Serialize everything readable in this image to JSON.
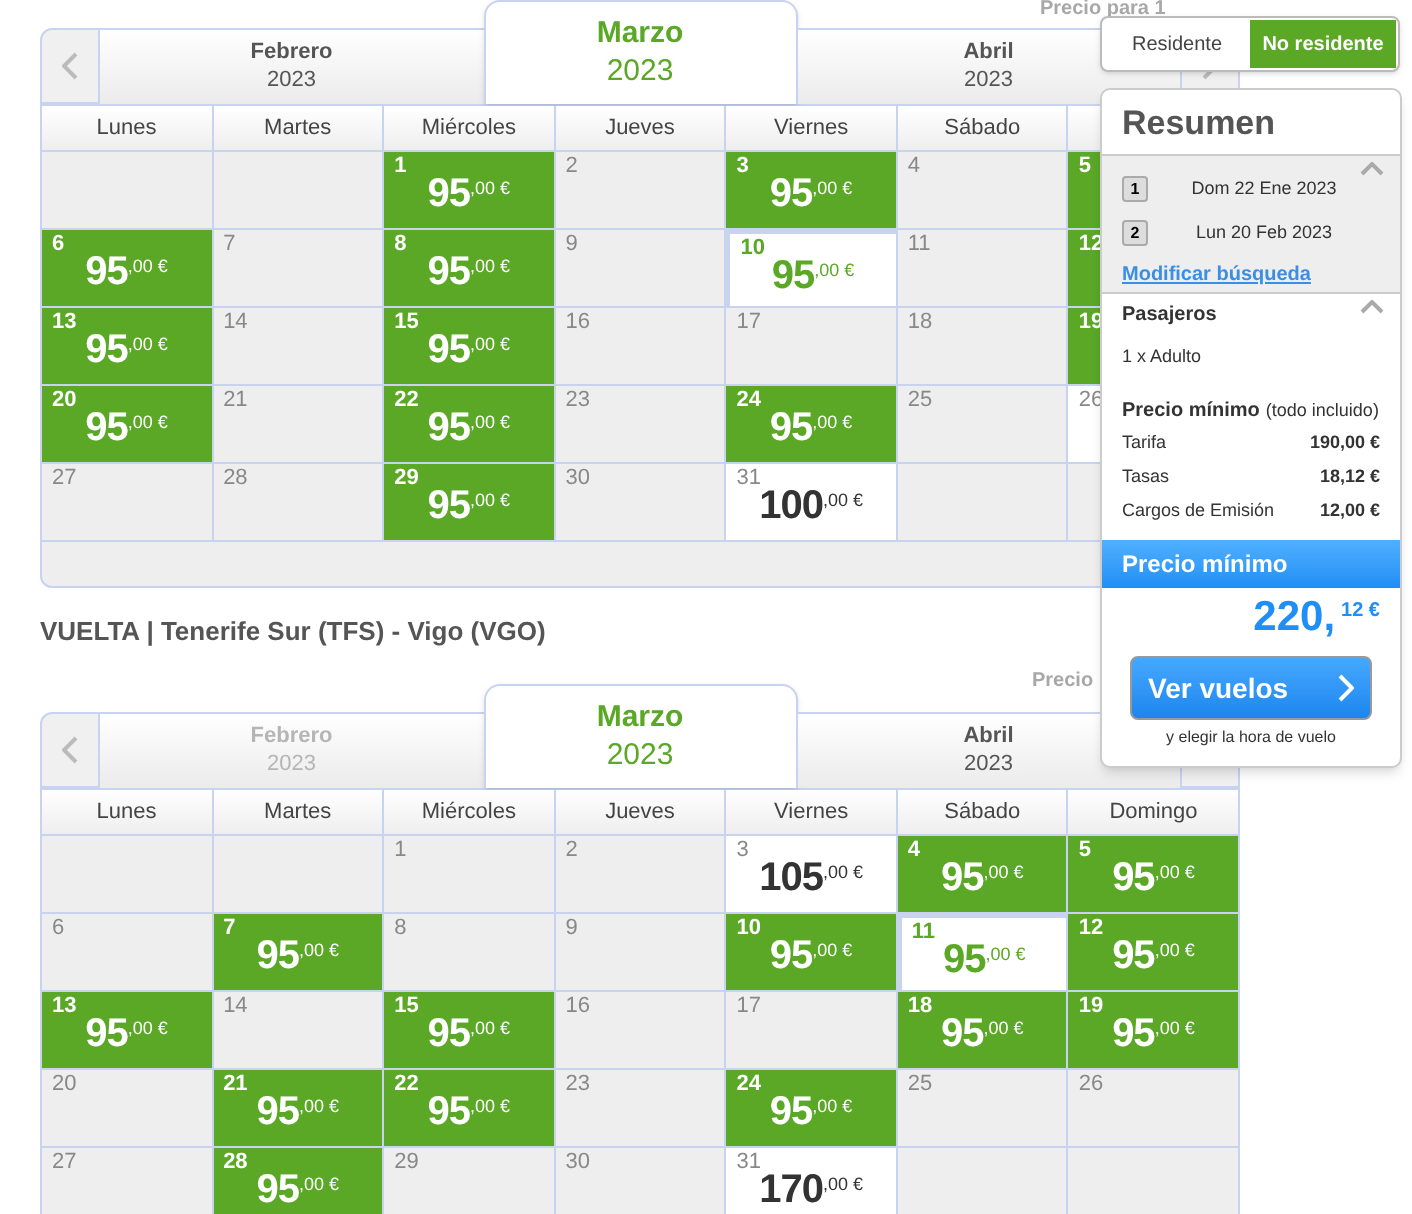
{
  "calendars": [
    {
      "price_note": "Precio para 1",
      "months": [
        {
          "name": "Febrero",
          "year": "2023",
          "selected": false,
          "disabled": false
        },
        {
          "name": "Marzo",
          "year": "2023",
          "selected": true,
          "disabled": false
        },
        {
          "name": "Abril",
          "year": "2023",
          "selected": false,
          "disabled": false
        }
      ],
      "weekdays": [
        "Lunes",
        "Martes",
        "Miércoles",
        "Jueves",
        "Viernes",
        "Sábado"
      ],
      "weeks": [
        [
          {
            "kind": "empty"
          },
          {
            "kind": "empty"
          },
          {
            "day": "1",
            "kind": "offer",
            "price": "95",
            "cents": ",00 €",
            "selected": false
          },
          {
            "day": "2",
            "kind": "closed"
          },
          {
            "day": "3",
            "kind": "offer",
            "price": "95",
            "cents": ",00 €",
            "selected": false
          },
          {
            "day": "4",
            "kind": "closed"
          },
          {
            "day": "5",
            "kind": "offer",
            "selected": false
          }
        ],
        [
          {
            "day": "6",
            "kind": "offer",
            "price": "95",
            "cents": ",00 €",
            "selected": false
          },
          {
            "day": "7",
            "kind": "closed"
          },
          {
            "day": "8",
            "kind": "offer",
            "price": "95",
            "cents": ",00 €",
            "selected": false
          },
          {
            "day": "9",
            "kind": "closed"
          },
          {
            "day": "10",
            "kind": "offer",
            "price": "95",
            "cents": ",00 €",
            "selected": true
          },
          {
            "day": "11",
            "kind": "closed"
          },
          {
            "day": "12",
            "kind": "offer",
            "selected": false
          }
        ],
        [
          {
            "day": "13",
            "kind": "offer",
            "price": "95",
            "cents": ",00 €",
            "selected": false
          },
          {
            "day": "14",
            "kind": "closed"
          },
          {
            "day": "15",
            "kind": "offer",
            "price": "95",
            "cents": ",00 €",
            "selected": false
          },
          {
            "day": "16",
            "kind": "closed"
          },
          {
            "day": "17",
            "kind": "closed"
          },
          {
            "day": "18",
            "kind": "closed"
          },
          {
            "day": "19",
            "kind": "offer",
            "selected": false
          }
        ],
        [
          {
            "day": "20",
            "kind": "offer",
            "price": "95",
            "cents": ",00 €",
            "selected": false
          },
          {
            "day": "21",
            "kind": "closed"
          },
          {
            "day": "22",
            "kind": "offer",
            "price": "95",
            "cents": ",00 €",
            "selected": false
          },
          {
            "day": "23",
            "kind": "closed"
          },
          {
            "day": "24",
            "kind": "offer",
            "price": "95",
            "cents": ",00 €",
            "selected": false
          },
          {
            "day": "25",
            "kind": "closed"
          },
          {
            "day": "26",
            "kind": "priced"
          }
        ],
        [
          {
            "day": "27",
            "kind": "closed"
          },
          {
            "day": "28",
            "kind": "closed"
          },
          {
            "day": "29",
            "kind": "offer",
            "price": "95",
            "cents": ",00 €",
            "selected": false
          },
          {
            "day": "30",
            "kind": "closed"
          },
          {
            "day": "31",
            "kind": "priced",
            "price": "100",
            "cents": ",00 €"
          },
          {
            "kind": "empty"
          },
          {
            "kind": "empty"
          }
        ]
      ]
    },
    {
      "title": "VUELTA | Tenerife Sur (TFS) - Vigo (VGO)",
      "price_note": "Precio",
      "months": [
        {
          "name": "Febrero",
          "year": "2023",
          "selected": false,
          "disabled": true
        },
        {
          "name": "Marzo",
          "year": "2023",
          "selected": true,
          "disabled": false
        },
        {
          "name": "Abril",
          "year": "2023",
          "selected": false,
          "disabled": false
        }
      ],
      "weekdays": [
        "Lunes",
        "Martes",
        "Miércoles",
        "Jueves",
        "Viernes",
        "Sábado",
        "Domingo"
      ],
      "weeks": [
        [
          {
            "kind": "empty"
          },
          {
            "kind": "empty"
          },
          {
            "day": "1",
            "kind": "closed"
          },
          {
            "day": "2",
            "kind": "closed"
          },
          {
            "day": "3",
            "kind": "priced",
            "price": "105",
            "cents": ",00 €"
          },
          {
            "day": "4",
            "kind": "offer",
            "price": "95",
            "cents": ",00 €",
            "selected": false
          },
          {
            "day": "5",
            "kind": "offer",
            "price": "95",
            "cents": ",00 €",
            "selected": false
          }
        ],
        [
          {
            "day": "6",
            "kind": "closed"
          },
          {
            "day": "7",
            "kind": "offer",
            "price": "95",
            "cents": ",00 €",
            "selected": false
          },
          {
            "day": "8",
            "kind": "closed"
          },
          {
            "day": "9",
            "kind": "closed"
          },
          {
            "day": "10",
            "kind": "offer",
            "price": "95",
            "cents": ",00 €",
            "selected": false
          },
          {
            "day": "11",
            "kind": "offer",
            "price": "95",
            "cents": ",00 €",
            "selected": true
          },
          {
            "day": "12",
            "kind": "offer",
            "price": "95",
            "cents": ",00 €",
            "selected": false
          }
        ],
        [
          {
            "day": "13",
            "kind": "offer",
            "price": "95",
            "cents": ",00 €",
            "selected": false
          },
          {
            "day": "14",
            "kind": "closed"
          },
          {
            "day": "15",
            "kind": "offer",
            "price": "95",
            "cents": ",00 €",
            "selected": false
          },
          {
            "day": "16",
            "kind": "closed"
          },
          {
            "day": "17",
            "kind": "closed"
          },
          {
            "day": "18",
            "kind": "offer",
            "price": "95",
            "cents": ",00 €",
            "selected": false
          },
          {
            "day": "19",
            "kind": "offer",
            "price": "95",
            "cents": ",00 €",
            "selected": false
          }
        ],
        [
          {
            "day": "20",
            "kind": "closed"
          },
          {
            "day": "21",
            "kind": "offer",
            "price": "95",
            "cents": ",00 €",
            "selected": false
          },
          {
            "day": "22",
            "kind": "offer",
            "price": "95",
            "cents": ",00 €",
            "selected": false
          },
          {
            "day": "23",
            "kind": "closed"
          },
          {
            "day": "24",
            "kind": "offer",
            "price": "95",
            "cents": ",00 €",
            "selected": false
          },
          {
            "day": "25",
            "kind": "closed"
          },
          {
            "day": "26",
            "kind": "closed"
          }
        ],
        [
          {
            "day": "27",
            "kind": "closed"
          },
          {
            "day": "28",
            "kind": "offer",
            "price": "95",
            "cents": ",00 €",
            "selected": false
          },
          {
            "day": "29",
            "kind": "closed"
          },
          {
            "day": "30",
            "kind": "closed"
          },
          {
            "day": "31",
            "kind": "priced",
            "price": "170",
            "cents": ",00 €"
          },
          {
            "kind": "empty"
          },
          {
            "kind": "empty"
          }
        ]
      ]
    }
  ],
  "fares": [
    {
      "label": "Residente",
      "selected": false
    },
    {
      "label": "No residente",
      "selected": true
    }
  ],
  "summary": {
    "title": "Resumen",
    "search": {
      "expanded": true,
      "flights": [
        {
          "num": "1",
          "date": "Dom 22 Ene 2023"
        },
        {
          "num": "2",
          "date": "Lun 20 Feb 2023"
        }
      ],
      "link": "Modificar búsqueda"
    },
    "passengers": {
      "title": "Pasajeros",
      "expanded": true,
      "value": "1 x Adulto"
    },
    "breakdown": {
      "title": "Precio mínimo",
      "note": "(todo incluido)",
      "rows": [
        {
          "label": "Tarifa",
          "value": "190,00 €"
        },
        {
          "label": "Tasas",
          "value": "18,12 €"
        },
        {
          "label": "Cargos de Emisión",
          "value": "12,00 €"
        }
      ]
    },
    "total": {
      "title": "Precio mínimo",
      "main": "220,",
      "cents": "12 €"
    },
    "button": "Ver vuelos",
    "hint": "y elegir la hora de vuelo"
  }
}
